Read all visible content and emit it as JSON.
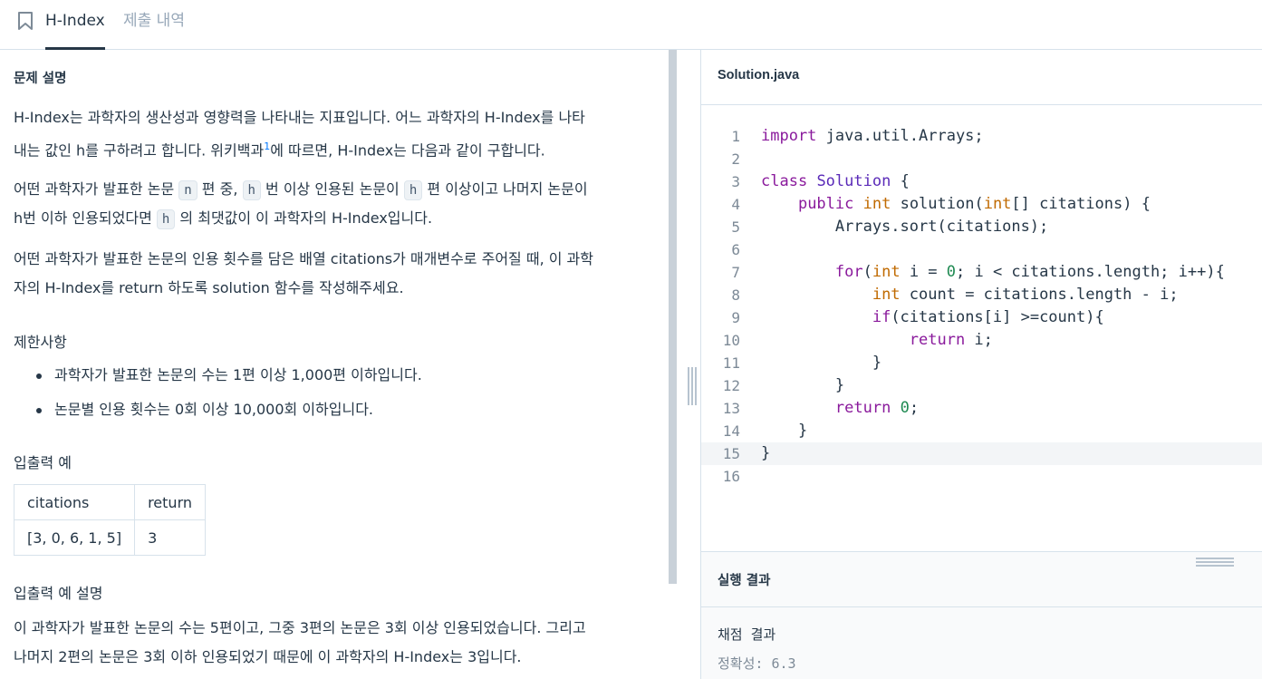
{
  "tabs": {
    "active": "H-Index",
    "inactive": "제출 내역"
  },
  "problem": {
    "title": "문제 설명",
    "p1_a": "H-Index는 과학자의 생산성과 영향력을 나타내는 지표입니다. 어느 과학자의 H-Index를 나타",
    "p1_b_1": "내는 값인 h를 구하려고 합니다. 위키백과",
    "p1_sup": "1",
    "p1_b_2": "에 따르면, H-Index는 다음과 같이 구합니다.",
    "p2_1": "어떤 과학자가 발표한 논문 ",
    "chip_n": "n",
    "p2_2": " 편 중, ",
    "chip_h1": "h",
    "p2_3": " 번 이상 인용된 논문이 ",
    "chip_h2": "h",
    "p2_4": " 편 이상이고 나머지 논문이",
    "p2_5": "h번 이하 인용되었다면 ",
    "chip_h3": "h",
    "p2_6": " 의 최댓값이 이 과학자의 H-Index입니다.",
    "p3_a": "어떤 과학자가 발표한 논문의 인용 횟수를 담은 배열 citations가 매개변수로 주어질 때, 이 과학",
    "p3_b": "자의 H-Index를 return 하도록 solution 함수를 작성해주세요."
  },
  "constraints": {
    "title": "제한사항",
    "items": [
      "과학자가 발표한 논문의 수는 1편 이상 1,000편 이하입니다.",
      "논문별 인용 횟수는 0회 이상 10,000회 이하입니다."
    ]
  },
  "io_example": {
    "title": "입출력 예",
    "headers": [
      "citations",
      "return"
    ],
    "rows": [
      [
        "[3, 0, 6, 1, 5]",
        "3"
      ]
    ]
  },
  "io_explanation": {
    "title": "입출력 예 설명",
    "line1": "이 과학자가 발표한 논문의 수는 5편이고, 그중 3편의 논문은 3회 이상 인용되었습니다. 그리고",
    "line2": "나머지 2편의 논문은 3회 이하 인용되었기 때문에 이 과학자의 H-Index는 3입니다."
  },
  "editor": {
    "file_name": "Solution.java",
    "line_numbers": [
      "1",
      "2",
      "3",
      "4",
      "5",
      "6",
      "7",
      "8",
      "9",
      "10",
      "11",
      "12",
      "13",
      "14",
      "15",
      "16"
    ],
    "active_line": 15
  },
  "result": {
    "title": "실행 결과",
    "line1": "채점 결과",
    "line2": "정확성: 6.3"
  },
  "icons": {
    "bookmark": "bookmark-icon"
  },
  "colors": {
    "text": "#263747",
    "muted": "#98a8b9",
    "keyword": "#8a1a9c",
    "type": "#c06a00",
    "number": "#1f8a52",
    "border": "#d7e2eb"
  }
}
